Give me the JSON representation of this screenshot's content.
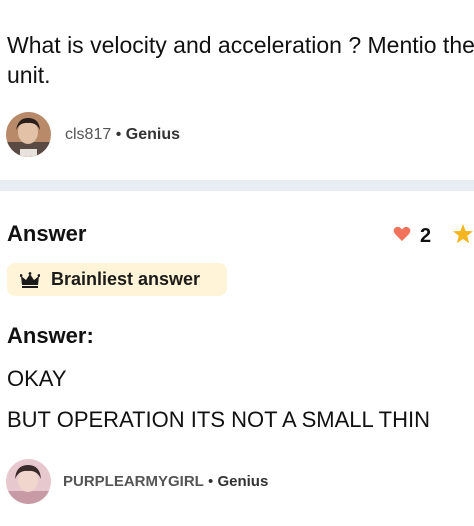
{
  "question": {
    "text": "What is velocity and acceleration ? Mentio their SI unit."
  },
  "asker": {
    "username": "cls817",
    "separator": "•",
    "rank": "Genius"
  },
  "answer": {
    "heading": "Answer",
    "likes": "2",
    "badge_label": "Brainliest answer",
    "body_heading": "Answer:",
    "body_line_1": "OKAY",
    "body_line_2": "BUT OPERATION ITS NOT A SMALL THIN"
  },
  "answerer": {
    "username": "PURPLEARMYGIRL",
    "separator": "•",
    "rank": "Genius"
  },
  "icons": {
    "heart": "heart-icon",
    "star": "star-icon",
    "crown": "crown-icon"
  },
  "colors": {
    "heart": "#f2725b",
    "star": "#f5b51e",
    "badge_bg": "#fff4d7",
    "divider": "#e9eef5"
  }
}
